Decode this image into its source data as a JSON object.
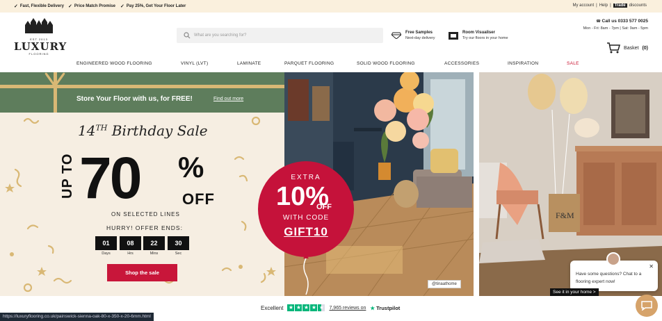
{
  "topbar": {
    "usps": [
      "Fast, Flexible Delivery",
      "Price Match Promise",
      "Pay 25%, Get Your Floor Later"
    ],
    "my_account": "My account",
    "help": "Help",
    "trade": "Trade",
    "discounts": "discounts"
  },
  "header": {
    "logo": {
      "est": "EST 2013",
      "name": "LUXURY",
      "sub": "FLOORING"
    },
    "search_placeholder": "What are you searching for?",
    "free_samples_title": "Free Samples",
    "free_samples_sub": "Next-day delivery",
    "visualiser_title": "Room Visualiser",
    "visualiser_sub": "Try our floors in your home",
    "call": "Call us 0333 577 0025",
    "hours": "Mon - Fri: 8am - 7pm | Sat: 9am - 5pm",
    "basket_label": "Basket",
    "basket_count": "(0)"
  },
  "nav": [
    "ENGINEERED WOOD FLOORING",
    "VINYL (LVT)",
    "LAMINATE",
    "PARQUET FLOORING",
    "SOLID WOOD FLOORING",
    "ACCESSORIES",
    "INSPIRATION",
    "SALE"
  ],
  "promo": {
    "store_text": "Store Your Floor with us, for FREE!",
    "find_out": "Find out more",
    "birthday_prefix": "14",
    "birthday_sup": "TH",
    "birthday_rest": " Birthday Sale",
    "up_to": "UP TO",
    "percent_number": "70",
    "percent_sign": "%",
    "off": "OFF",
    "selected": "ON SELECTED LINES",
    "hurry": "HURRY! OFFER ENDS:",
    "countdown": [
      {
        "value": "01",
        "label": "Days"
      },
      {
        "value": "08",
        "label": "Hrs"
      },
      {
        "value": "22",
        "label": "Mins"
      },
      {
        "value": "30",
        "label": "Sec"
      }
    ],
    "shop_button": "Shop the sale",
    "balloon": {
      "extra": "EXTRA",
      "ten": "10%",
      "off": "OFF",
      "with_code": "WITH CODE",
      "code": "GIFT10"
    }
  },
  "photo1_credit": "@tinaathome",
  "trustpilot": {
    "excellent": "Excellent",
    "reviews": "7,965 reviews on",
    "brand": "Trustpilot"
  },
  "status_url": "https://luxuryflooring.co.uk/painswick-sienna-oak-80-x-350-x-20-6mm.html",
  "chat": {
    "message": "Have some questions? Chat to a flooring expert now!",
    "see_home": "See it in your home >"
  },
  "colors": {
    "accent_red": "#c8163a",
    "green_bar": "#5e7d5c",
    "cream": "#f6eee2",
    "trustpilot_green": "#00b67a"
  }
}
